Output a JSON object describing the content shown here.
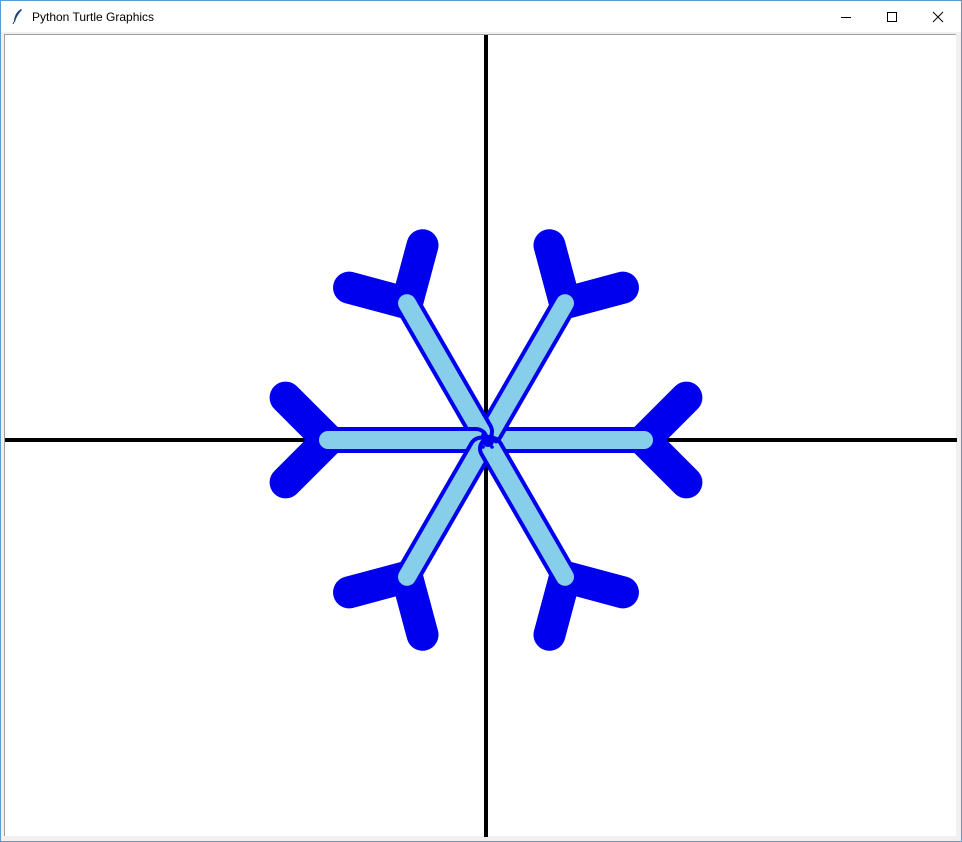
{
  "window": {
    "title": "Python Turtle Graphics",
    "icon": "feather-icon",
    "controls": [
      "minimize-icon",
      "maximize-icon",
      "close-icon"
    ]
  },
  "canvas": {
    "background": "#ffffff",
    "axis_color": "#000000",
    "arm_outline_color": "#0000ee",
    "arm_fill_color": "#87ceeb",
    "branch_color": "#0000ee",
    "turtle_color": "#0000ee",
    "arm_count": 6
  }
}
